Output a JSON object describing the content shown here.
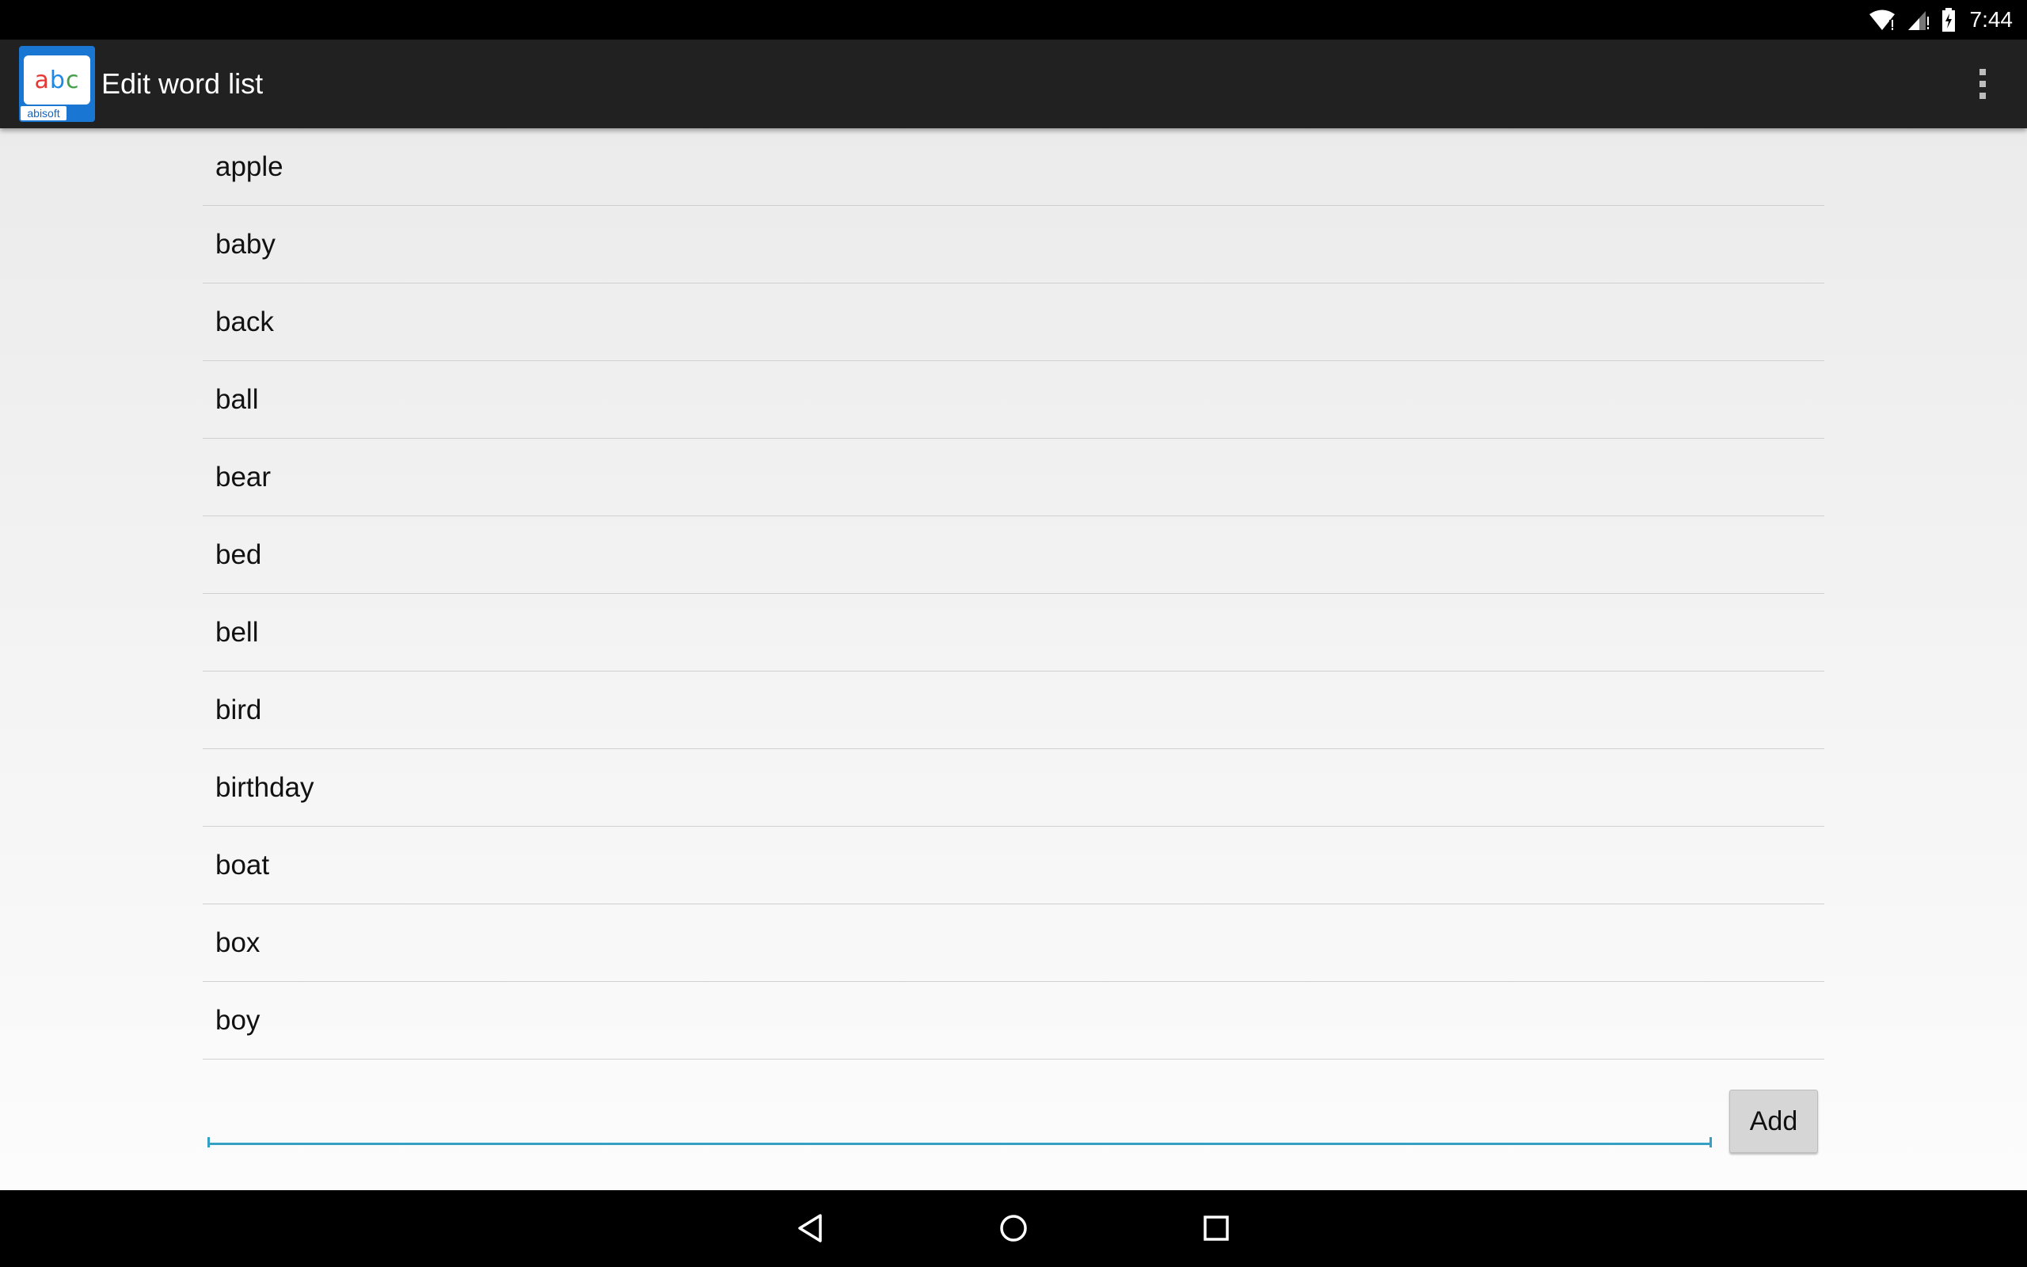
{
  "status_bar": {
    "time": "7:44",
    "icons": [
      "wifi-icon",
      "signal-icon",
      "battery-charging-icon"
    ]
  },
  "action_bar": {
    "app_icon": {
      "letters": [
        "a",
        "b",
        "c"
      ],
      "brand": "abisoft",
      "colors": {
        "a": "#e53935",
        "b": "#1e88e5",
        "c": "#43a047",
        "background": "#1976d2"
      }
    },
    "title": "Edit word list",
    "overflow_icon": "overflow-menu-icon"
  },
  "word_list": {
    "items": [
      "apple",
      "baby",
      "back",
      "ball",
      "bear",
      "bed",
      "bell",
      "bird",
      "birthday",
      "boat",
      "box",
      "boy"
    ]
  },
  "add_word": {
    "input_value": "",
    "input_placeholder": "",
    "button_label": "Add",
    "accent_color": "#33a0c4"
  },
  "nav_bar": {
    "buttons": [
      "back-icon",
      "home-icon",
      "recents-icon"
    ]
  }
}
